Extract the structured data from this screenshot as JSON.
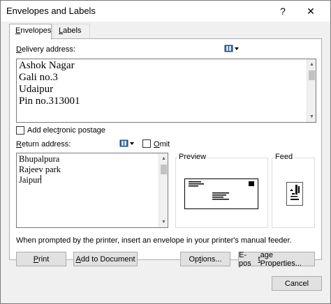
{
  "window": {
    "title": "Envelopes and Labels",
    "help_glyph": "?",
    "close_glyph": "✕"
  },
  "tabs": [
    {
      "label": "Envelopes",
      "mnemonic": "E",
      "rest": "nvelopes",
      "active": true
    },
    {
      "label": "Labels",
      "mnemonic": "L",
      "rest": "abels",
      "active": false
    }
  ],
  "delivery": {
    "label_mnemonic": "D",
    "label_rest": "elivery address:",
    "lines": [
      "Ashok Nagar",
      "Gali no.3",
      "Udaipur",
      "Pin no.313001"
    ]
  },
  "electronic_postage": {
    "label_pre": "Add elec",
    "label_mnemonic": "t",
    "label_post": "ronic postage",
    "checked": false
  },
  "return": {
    "label_mnemonic": "R",
    "label_rest": "eturn address:",
    "lines": [
      "Bhupalpura",
      "Rajeev park",
      "Jaipur"
    ],
    "omit_mnemonic": "O",
    "omit_rest": "mit",
    "omit_checked": false
  },
  "preview": {
    "title": "Preview"
  },
  "feed": {
    "title": "Feed"
  },
  "info": {
    "text": "When prompted by the printer, insert an envelope in your printer's manual feeder."
  },
  "buttons": {
    "print_mnemonic": "P",
    "print_rest": "rint",
    "add_mnemonic": "A",
    "add_rest": "dd to Document",
    "options_pre": "Op",
    "options_mnemonic": "t",
    "options_post": "ions...",
    "epostage_pre": "E-pos",
    "epostage_mnemonic": "t",
    "epostage_post": "age Properties...",
    "cancel": "Cancel"
  },
  "icons": {
    "address_book": "address-book-icon",
    "dropdown": "chevron-down-icon",
    "help": "help-icon",
    "close": "close-icon"
  },
  "colors": {
    "window_bg": "#f0f0f0",
    "panel_bg": "#ffffff",
    "button_bg": "#e1e1e1",
    "border": "#adadad"
  }
}
